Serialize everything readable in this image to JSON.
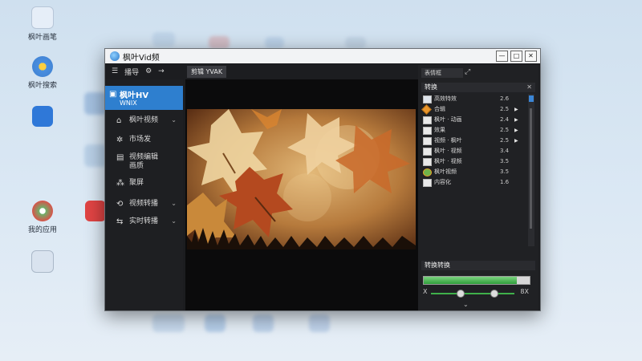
{
  "desktop": {
    "icons": [
      {
        "label": "枫叶画笔",
        "color": "#e6eef8"
      },
      {
        "label": "枫叶搜索",
        "color": "#4a8fe0"
      },
      {
        "label": "",
        "color": "#2f78d8"
      },
      {
        "label": "我的应用",
        "color": "#6bb36b"
      },
      {
        "label": "",
        "color": "#e04444"
      },
      {
        "label": "",
        "color": "#d9e3ef"
      }
    ]
  },
  "window": {
    "title": "枫叶Vid频",
    "controls": [
      "—",
      "□",
      "✕"
    ]
  },
  "toolbar": {
    "menu_label": "播导"
  },
  "sidebar": {
    "active": {
      "title": "枫叶HV",
      "subtitle": "WNIX"
    },
    "items": [
      {
        "label": "枫叶视频",
        "icon": "home-icon",
        "has_chevron": true
      },
      {
        "label": "市场发",
        "icon": "settings-icon",
        "has_chevron": false
      },
      {
        "label": "视频编辑",
        "sublabel": "画质",
        "icon": "edit-icon",
        "has_chevron": false
      },
      {
        "label": "聚屏",
        "icon": "grid-icon",
        "has_chevron": false
      },
      {
        "label": "视频转播",
        "icon": "refresh-icon",
        "has_chevron": true
      },
      {
        "label": "实时转播",
        "icon": "transfer-icon",
        "has_chevron": true
      }
    ]
  },
  "tabs": [
    {
      "label": "剪辑 YVAK"
    }
  ],
  "right_panel": {
    "search_placeholder": "表情框",
    "header": "转换",
    "files": [
      {
        "name": "高效特效",
        "size": "2.6",
        "type": "folder"
      },
      {
        "name": "合辑",
        "size": "2.5",
        "type": "folder-orange"
      },
      {
        "name": "枫叶 · 动画",
        "size": "2.4",
        "type": "file"
      },
      {
        "name": "效果",
        "size": "2.5",
        "type": "file"
      },
      {
        "name": "视频 · 枫叶",
        "size": "2.5",
        "type": "file"
      },
      {
        "name": "枫叶 · 视频",
        "size": "3.4",
        "type": "file"
      },
      {
        "name": "枫叶 · 视频",
        "size": "3.5",
        "type": "file"
      },
      {
        "name": "枫叶视频",
        "size": "3.5",
        "type": "leaf"
      },
      {
        "name": "内容化",
        "size": "1.6",
        "type": "file"
      }
    ],
    "progress_section": "转换转换",
    "progress": 0.88,
    "slider": {
      "left_label": "X",
      "right_label": "8X",
      "low": 0.35,
      "high": 0.75
    }
  },
  "colors": {
    "accent": "#2e7fcf",
    "progress": "#2f9e3a",
    "window_bg": "#1c1d20"
  }
}
